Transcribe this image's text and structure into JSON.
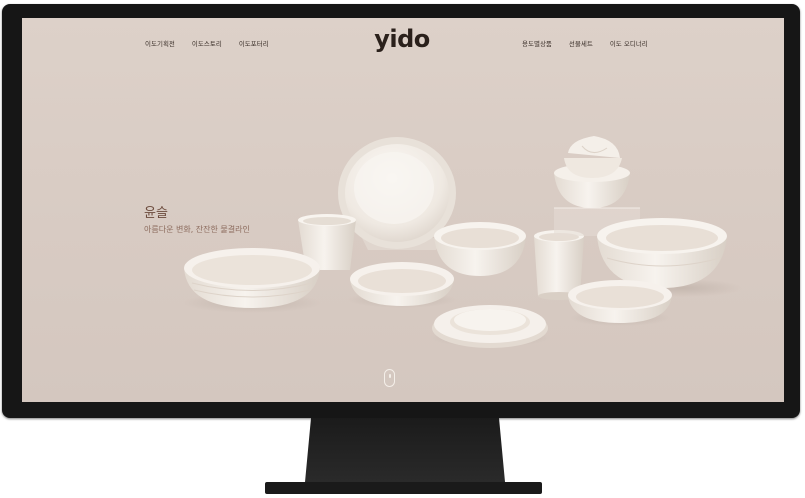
{
  "nav": {
    "left": [
      "이도기획전",
      "이도스토리",
      "이도포터리"
    ],
    "logo": "yido",
    "right": [
      "용도별상품",
      "선물세트",
      "이도 오디너리"
    ]
  },
  "hero": {
    "title": "윤슬",
    "subtitle": "아름다운 변화, 잔잔한 물결라인"
  },
  "colors": {
    "background": "#d9ccc4",
    "ceramic": "#f4efe9",
    "logo": "#2a201b",
    "hero_title": "#6b4a3c",
    "bezel": "#161616"
  },
  "icons": [
    "scroll-mouse-icon"
  ]
}
